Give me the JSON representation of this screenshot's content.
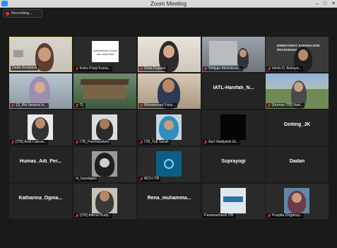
{
  "window": {
    "title": "Zoom Meeting",
    "controls": [
      "–",
      "□",
      "✕"
    ]
  },
  "recording": {
    "label": "Recording..."
  },
  "participants": [
    {
      "name": "Dede Kosiwara",
      "video": true,
      "active": true
    },
    {
      "name": "Koko Panji Koma...",
      "video": true,
      "slide_text": "Administrasi Umum dan Informasi"
    },
    {
      "name": "Dewi Rupiani",
      "video": true
    },
    {
      "name": "Widjaja Martokusu...",
      "video": true
    },
    {
      "name": "Herto D. Ariesya...",
      "video": true,
      "sign_text": "DIREKTORAT SARANA DAN PRASARANA"
    },
    {
      "name": "13_Ria Ismaria Is...",
      "video": true
    },
    {
      "name": "TL",
      "video": true
    },
    {
      "name": "Muhammad Fariz...",
      "video": true
    },
    {
      "name": "[Humas ITB] Nad...",
      "video": true
    },
    {
      "name": "[ITB] Andi Cakrav...",
      "video": true
    },
    {
      "name": "ITB_Poerbandono",
      "video": true
    },
    {
      "name": "ITB_Tuti Sarah",
      "video": true
    },
    {
      "name": "Asri Hadiyanti Gi...",
      "video": true
    },
    {
      "name": "m_handajani",
      "video": true
    },
    {
      "name": "MCH ITB",
      "video": true
    },
    {
      "name": "[ITB] Alfend Rudy...",
      "video": true
    },
    {
      "name": "Paramashanti ITB",
      "video": true
    },
    {
      "name": "Puspita Dirgahay...",
      "video": true
    }
  ],
  "text_only_tiles": [
    {
      "label": "IATL-Hanifah_N..."
    },
    {
      "label": "Ginting_JK"
    },
    {
      "label": "Humas_Adi_Per..."
    },
    {
      "label": "Suprayogi"
    },
    {
      "label": "Dadan"
    },
    {
      "label": "Katharina_Ogina..."
    },
    {
      "label": "Rena_muhamma..."
    }
  ]
}
